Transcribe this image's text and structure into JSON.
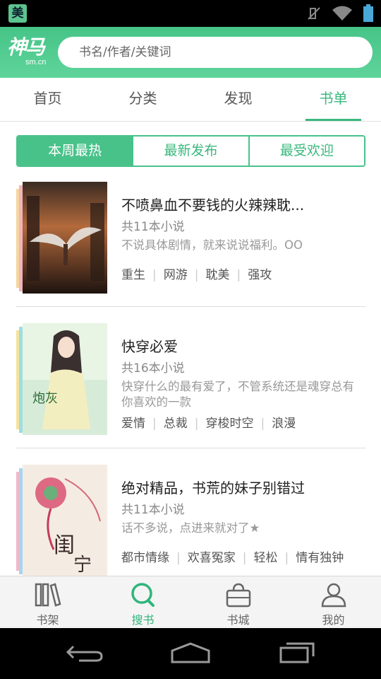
{
  "status_bar": {
    "app_badge": "美"
  },
  "header": {
    "logo_main": "神马",
    "logo_sub": "sm.cn",
    "search_placeholder": "书名/作者/关键词"
  },
  "tabs": [
    {
      "label": "首页"
    },
    {
      "label": "分类"
    },
    {
      "label": "发现"
    },
    {
      "label": "书单",
      "active": true
    }
  ],
  "segments": [
    {
      "label": "本周最热",
      "active": true
    },
    {
      "label": "最新发布"
    },
    {
      "label": "最受欢迎"
    }
  ],
  "booklists": [
    {
      "title": "不喷鼻血不要钱的火辣辣耽...",
      "count": "共11本小说",
      "desc": "不说具体剧情，就来说说福利。OO",
      "tags": [
        "重生",
        "网游",
        "耽美",
        "强攻"
      ]
    },
    {
      "title": "快穿必爱",
      "count": "共16本小说",
      "desc": "快穿什么的最有爱了，不管系统还是魂穿总有你喜欢的一款",
      "tags": [
        "爱情",
        "总裁",
        "穿梭时空",
        "浪漫"
      ]
    },
    {
      "title": "绝对精品，书荒的妹子别错过",
      "count": "共11本小说",
      "desc": "话不多说，点进来就对了★",
      "tags": [
        "都市情缘",
        "欢喜冤家",
        "轻松",
        "情有独钟"
      ]
    }
  ],
  "bottom_nav": [
    {
      "label": "书架",
      "icon": "bookshelf-icon"
    },
    {
      "label": "搜书",
      "icon": "search-icon",
      "active": true
    },
    {
      "label": "书城",
      "icon": "shopping-bag-icon"
    },
    {
      "label": "我的",
      "icon": "user-icon"
    }
  ],
  "colors": {
    "accent": "#3bb87e",
    "header": "#4fca8e"
  }
}
